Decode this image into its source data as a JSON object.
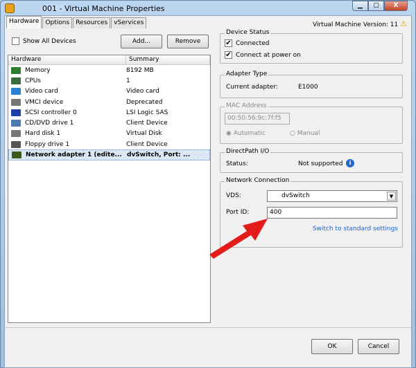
{
  "window": {
    "title": "001 - Virtual Machine Properties",
    "minimize": "▁",
    "maximize": "▢",
    "close": "X"
  },
  "tabs": [
    "Hardware",
    "Options",
    "Resources",
    "vServices"
  ],
  "vm_version": "Virtual Machine Version: 11",
  "show_all_devices": "Show All Devices",
  "add_label": "Add...",
  "remove_label": "Remove",
  "list": {
    "headers": [
      "Hardware",
      "Summary"
    ],
    "rows": [
      {
        "name": "Memory",
        "summary": "8192 MB",
        "color": "#2f7d2f"
      },
      {
        "name": "CPUs",
        "summary": "1",
        "color": "#3a6b3a"
      },
      {
        "name": "Video card",
        "summary": "Video card",
        "color": "#2a7fd6"
      },
      {
        "name": "VMCI device",
        "summary": "Deprecated",
        "color": "#777777"
      },
      {
        "name": "SCSI controller 0",
        "summary": "LSI Logic SAS",
        "color": "#1d3fa8"
      },
      {
        "name": "CD/DVD drive 1",
        "summary": "Client Device",
        "color": "#4a7ab0"
      },
      {
        "name": "Hard disk 1",
        "summary": "Virtual Disk",
        "color": "#777777"
      },
      {
        "name": "Floppy drive 1",
        "summary": "Client Device",
        "color": "#555555"
      },
      {
        "name": "Network adapter 1 (edite...",
        "summary": "dvSwitch, Port: ...",
        "color": "#3b5a1e"
      }
    ]
  },
  "device_status": {
    "legend": "Device Status",
    "connected": "Connected",
    "connect_power": "Connect at power on"
  },
  "adapter": {
    "legend": "Adapter Type",
    "label": "Current adapter:",
    "value": "E1000"
  },
  "mac": {
    "legend": "MAC Address",
    "value": "00:50:56:9c:7f:f5",
    "automatic": "Automatic",
    "manual": "Manual"
  },
  "directpath": {
    "legend": "DirectPath I/O",
    "label": "Status:",
    "value": "Not supported"
  },
  "network": {
    "legend": "Network Connection",
    "vds_label": "VDS:",
    "vds_value": "dvSwitch",
    "port_label": "Port ID:",
    "port_value": "400",
    "switch_link": "Switch to standard settings"
  },
  "ok_label": "OK",
  "cancel_label": "Cancel"
}
